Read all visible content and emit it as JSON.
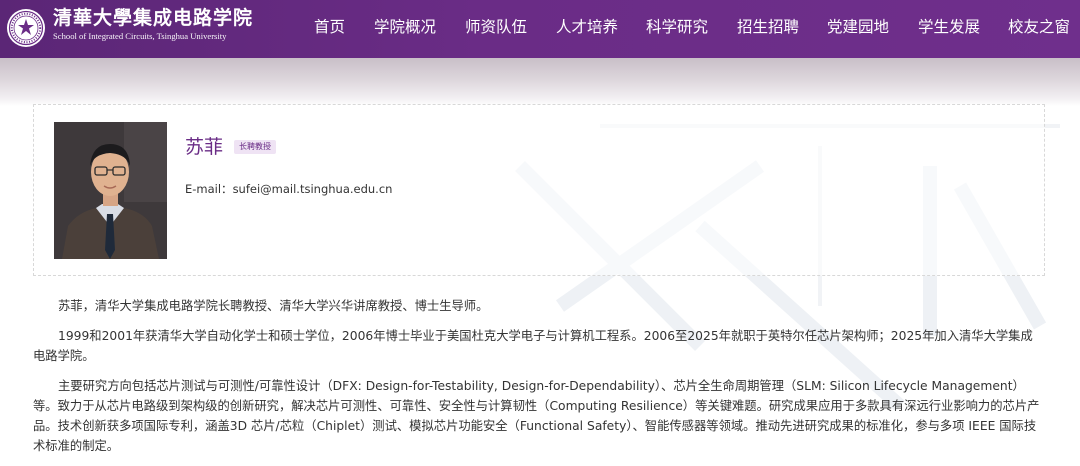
{
  "header": {
    "brand_cn": "清華大學集成电路学院",
    "brand_en": "School of Integrated Circuits, Tsinghua University",
    "brand_color": "#6a2c86",
    "nav": [
      {
        "label": "首页"
      },
      {
        "label": "学院概况"
      },
      {
        "label": "师资队伍"
      },
      {
        "label": "人才培养"
      },
      {
        "label": "科学研究"
      },
      {
        "label": "招生招聘"
      },
      {
        "label": "党建园地"
      },
      {
        "label": "学生发展"
      },
      {
        "label": "校友之窗"
      }
    ]
  },
  "profile": {
    "name": "苏菲",
    "title_tag": "长聘教授",
    "email_label": "E-mail：",
    "email": "sufei@mail.tsinghua.edu.cn"
  },
  "bio": {
    "p1": "苏菲，清华大学集成电路学院长聘教授、清华大学兴华讲席教授、博士生导师。",
    "p2": "1999和2001年获清华大学自动化学士和硕士学位，2006年博士毕业于美国杜克大学电子与计算机工程系。2006至2025年就职于英特尔任芯片架构师；2025年加入清华大学集成电路学院。",
    "p3": "主要研究方向包括芯片测试与可测性/可靠性设计（DFX: Design-for-Testability, Design-for-Dependability）、芯片全生命周期管理（SLM: Silicon Lifecycle Management）等。致力于从芯片电路级到架构级的创新研究，解决芯片可测性、可靠性、安全性与计算韧性（Computing Resilience）等关键难题。研究成果应用于多款具有深远行业影响力的芯片产品。技术创新获多项国际专利，涵盖3D 芯片/芯粒（Chiplet）测试、模拟芯片功能安全（Functional Safety）、智能传感器等领域。推动先进研究成果的标准化，参与多项 IEEE 国际技术标准的制定。"
  }
}
